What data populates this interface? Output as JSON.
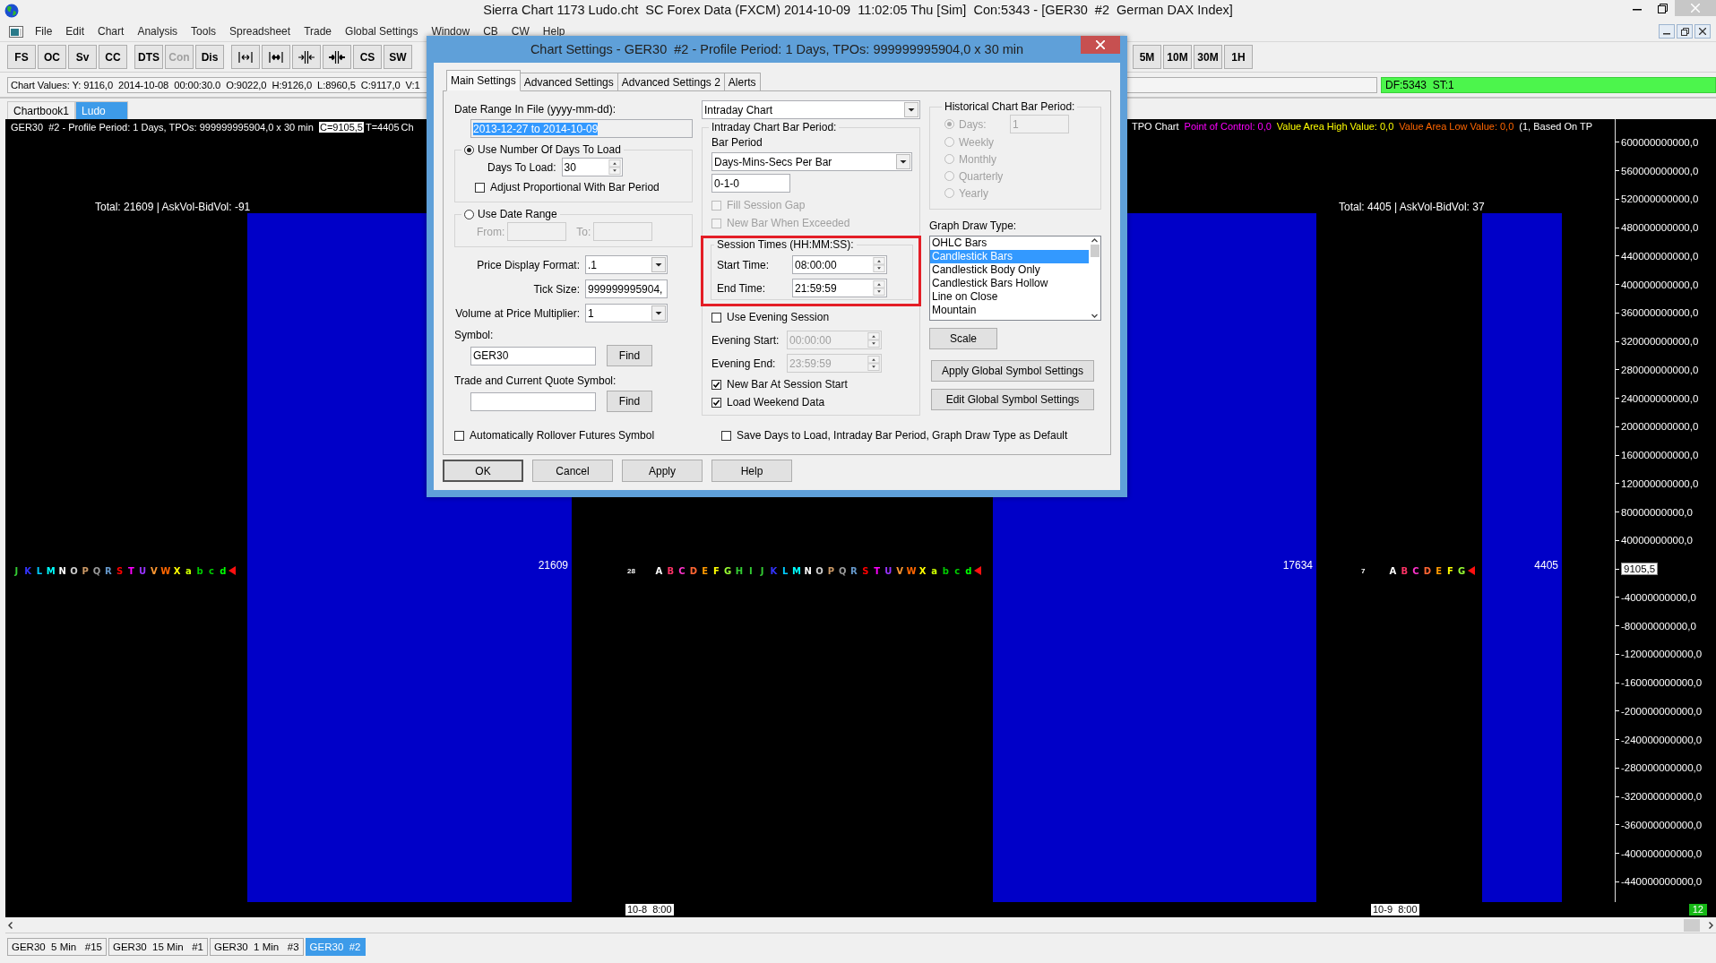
{
  "app": {
    "title": "Sierra Chart 1173 Ludo.cht  SC Forex Data (FXCM) 2014-10-09  11:02:05 Thu [Sim]  Con:5343 - [GER30  #2  German DAX Index]"
  },
  "menu": [
    "File",
    "Edit",
    "Chart",
    "Analysis",
    "Tools",
    "Spreadsheet",
    "Trade",
    "Global Settings",
    "Window",
    "CB",
    "CW",
    "Help"
  ],
  "toolbar": {
    "group_1": [
      {
        "label": "FS",
        "disabled": false
      },
      {
        "label": "OC",
        "disabled": false
      },
      {
        "label": "Sv",
        "disabled": false
      },
      {
        "label": "CC",
        "disabled": false
      }
    ],
    "group_2": [
      {
        "label": "DTS",
        "disabled": false
      },
      {
        "label": "Con",
        "disabled": true
      },
      {
        "label": "Dis",
        "disabled": false
      }
    ],
    "group_3": [
      {
        "label": "CS",
        "disabled": false
      },
      {
        "label": "SW",
        "disabled": false
      }
    ],
    "group_4": [
      {
        "label": "5M",
        "disabled": false
      },
      {
        "label": "10M",
        "disabled": false
      },
      {
        "label": "30M",
        "disabled": false
      },
      {
        "label": "1H",
        "disabled": false
      }
    ]
  },
  "chart_values": "Chart Values: Y: 9116,0  2014-10-08  00:00:30.0  O:9022,0  H:9126,0  L:8960,5  C:9117,0  V:1",
  "status": "DF:5343  ST:1",
  "chartbook_tabs": [
    {
      "label": "Chartbook1",
      "selected": false
    },
    {
      "label": "Ludo",
      "selected": true
    }
  ],
  "chart": {
    "header": {
      "study": "GER30  #2 - Profile Period: 1 Days, TPOs: 999999995904,0 x 30 min",
      "close": "C=9105,5",
      "tpo_count": "T=4405",
      "cut": "Ch"
    },
    "legend": [
      {
        "text": "TPO Chart",
        "color": "#ffffff"
      },
      {
        "text": "Point of Control: 0,0",
        "color": "#ff00ff"
      },
      {
        "text": "Value Area High Value: 0,0",
        "color": "#ffff00"
      },
      {
        "text": "Value Area Low Value: 0,0",
        "color": "#ff6600"
      },
      {
        "text": "(1, Based On TP",
        "color": "#ffffff"
      }
    ],
    "profiles": [
      {
        "total": "Total: 21609 | AskVol-BidVol: -91",
        "volume": "21609",
        "letters": [
          {
            "letter": "J",
            "color": "#33cc33"
          },
          {
            "letter": "K",
            "color": "#3333ff"
          },
          {
            "letter": "L",
            "color": "#00ccff"
          },
          {
            "letter": "M",
            "color": "#00ffff"
          },
          {
            "letter": "N",
            "color": "#ffffff"
          },
          {
            "letter": "O",
            "color": "#cccccc"
          },
          {
            "letter": "P",
            "color": "#cc9966"
          },
          {
            "letter": "Q",
            "color": "#999999"
          },
          {
            "letter": "R",
            "color": "#6699cc"
          },
          {
            "letter": "S",
            "color": "#ff0000"
          },
          {
            "letter": "T",
            "color": "#ff00ff"
          },
          {
            "letter": "U",
            "color": "#9933ff"
          },
          {
            "letter": "V",
            "color": "#ff9933"
          },
          {
            "letter": "W",
            "color": "#ff6600"
          },
          {
            "letter": "X",
            "color": "#ffff00"
          },
          {
            "letter": "a",
            "color": "#ccff00"
          },
          {
            "letter": "b",
            "color": "#00cc00"
          },
          {
            "letter": "c",
            "color": "#00cc00"
          },
          {
            "letter": "d",
            "color": "#00ff00"
          }
        ]
      },
      {
        "count": "28",
        "volume": "17634",
        "letters": [
          {
            "letter": "A",
            "color": "#ffffff"
          },
          {
            "letter": "B",
            "color": "#ff3366"
          },
          {
            "letter": "C",
            "color": "#ff33cc"
          },
          {
            "letter": "D",
            "color": "#ff6633"
          },
          {
            "letter": "E",
            "color": "#ff9900"
          },
          {
            "letter": "F",
            "color": "#ffff00"
          },
          {
            "letter": "G",
            "color": "#99ff33"
          },
          {
            "letter": "H",
            "color": "#33cc33"
          },
          {
            "letter": "I",
            "color": "#33cc33"
          },
          {
            "letter": "J",
            "color": "#33cc33"
          },
          {
            "letter": "K",
            "color": "#3333ff"
          },
          {
            "letter": "L",
            "color": "#00ccff"
          },
          {
            "letter": "M",
            "color": "#00ffff"
          },
          {
            "letter": "N",
            "color": "#ffffff"
          },
          {
            "letter": "O",
            "color": "#cccccc"
          },
          {
            "letter": "P",
            "color": "#cc9966"
          },
          {
            "letter": "Q",
            "color": "#999999"
          },
          {
            "letter": "R",
            "color": "#6699cc"
          },
          {
            "letter": "S",
            "color": "#ff0000"
          },
          {
            "letter": "T",
            "color": "#ff00ff"
          },
          {
            "letter": "U",
            "color": "#9933ff"
          },
          {
            "letter": "V",
            "color": "#ff9933"
          },
          {
            "letter": "W",
            "color": "#ff6600"
          },
          {
            "letter": "X",
            "color": "#ffff00"
          },
          {
            "letter": "a",
            "color": "#ccff00"
          },
          {
            "letter": "b",
            "color": "#00cc00"
          },
          {
            "letter": "c",
            "color": "#00cc00"
          },
          {
            "letter": "d",
            "color": "#00ff00"
          }
        ]
      },
      {
        "total": "Total: 4405 | AskVol-BidVol: 37",
        "count": "7",
        "volume": "4405",
        "letters": [
          {
            "letter": "A",
            "color": "#ffffff"
          },
          {
            "letter": "B",
            "color": "#ff3366"
          },
          {
            "letter": "C",
            "color": "#ff33cc"
          },
          {
            "letter": "D",
            "color": "#ff6633"
          },
          {
            "letter": "E",
            "color": "#ff9900"
          },
          {
            "letter": "F",
            "color": "#ffff00"
          },
          {
            "letter": "G",
            "color": "#99ff33"
          }
        ]
      }
    ],
    "price_axis": [
      {
        "label": "600000000000,0",
        "kind": "tick"
      },
      {
        "label": "560000000000,0",
        "kind": "tick"
      },
      {
        "label": "520000000000,0",
        "kind": "tick"
      },
      {
        "label": "480000000000,0",
        "kind": "tick"
      },
      {
        "label": "440000000000,0",
        "kind": "tick"
      },
      {
        "label": "400000000000,0",
        "kind": "tick"
      },
      {
        "label": "360000000000,0",
        "kind": "tick"
      },
      {
        "label": "320000000000,0",
        "kind": "tick"
      },
      {
        "label": "280000000000,0",
        "kind": "tick"
      },
      {
        "label": "240000000000,0",
        "kind": "tick"
      },
      {
        "label": "200000000000,0",
        "kind": "tick"
      },
      {
        "label": "160000000000,0",
        "kind": "tick"
      },
      {
        "label": "120000000000,0",
        "kind": "tick"
      },
      {
        "label": "80000000000,0",
        "kind": "tick"
      },
      {
        "label": "40000000000,0",
        "kind": "tick"
      },
      {
        "label": "9105,5",
        "kind": "marker"
      },
      {
        "label": "-40000000000,0",
        "kind": "tick"
      },
      {
        "label": "-80000000000,0",
        "kind": "tick"
      },
      {
        "label": "-120000000000,0",
        "kind": "tick"
      },
      {
        "label": "-160000000000,0",
        "kind": "tick"
      },
      {
        "label": "-200000000000,0",
        "kind": "tick"
      },
      {
        "label": "-240000000000,0",
        "kind": "tick"
      },
      {
        "label": "-280000000000,0",
        "kind": "tick"
      },
      {
        "label": "-320000000000,0",
        "kind": "tick"
      },
      {
        "label": "-360000000000,0",
        "kind": "tick"
      },
      {
        "label": "-400000000000,0",
        "kind": "tick"
      },
      {
        "label": "-440000000000,0",
        "kind": "tick"
      }
    ],
    "time_labels": [
      "10-8  8:00",
      "10-9  8:00"
    ],
    "bar_count": "12"
  },
  "bottom_tabs": [
    {
      "label": "GER30  5 Min   #15",
      "selected": false
    },
    {
      "label": "GER30  15 Min   #1",
      "selected": false
    },
    {
      "label": "GER30  1 Min   #3",
      "selected": false
    },
    {
      "label": "GER30  #2",
      "selected": true
    }
  ],
  "dialog": {
    "title": "Chart Settings - GER30  #2 - Profile Period: 1 Days, TPOs: 999999995904,0 x 30 min",
    "tabs": [
      {
        "label": "Main Settings",
        "selected": true
      },
      {
        "label": "Advanced Settings",
        "selected": false
      },
      {
        "label": "Advanced Settings 2",
        "selected": false
      },
      {
        "label": "Alerts",
        "selected": false
      }
    ],
    "date_range": {
      "label": "Date Range In File (yyyy-mm-dd):",
      "value": "2013-12-27 to 2014-10-09",
      "text_selected": true
    },
    "load_modes": [
      {
        "label": "Use Number Of Days To Load",
        "selected": true
      },
      {
        "label": "Use Date Range",
        "selected": false
      }
    ],
    "days_to_load": {
      "label": "Days To Load:",
      "value": "30"
    },
    "adjust_proportional": {
      "label": "Adjust Proportional With Bar Period",
      "checked": false,
      "disabled": false
    },
    "from": {
      "label": "From:",
      "disabled": true
    },
    "to": {
      "label": "To:",
      "disabled": true
    },
    "price_display_format": {
      "label": "Price Display Format:",
      "value": ".1"
    },
    "tick_size": {
      "label": "Tick Size:",
      "value": "999999995904,"
    },
    "volume_multiplier": {
      "label": "Volume at Price Multiplier:",
      "value": "1"
    },
    "symbol": {
      "label": "Symbol:",
      "value": "GER30",
      "button": "Find"
    },
    "quote_symbol": {
      "label": "Trade and Current Quote Symbol:",
      "button": "Find"
    },
    "rollover": {
      "label": "Automatically Rollover Futures Symbol",
      "checked": false,
      "disabled": false
    },
    "chart_type": "Intraday Chart",
    "intraday": {
      "title": "Intraday Chart Bar Period:",
      "bar_period_label": "Bar Period",
      "bar_period_type": "Days-Mins-Secs Per Bar",
      "bar_period_value": "0-1-0",
      "options": [
        {
          "label": "Fill Session Gap",
          "checked": false,
          "disabled": true
        },
        {
          "label": "New Bar When Exceeded",
          "checked": false,
          "disabled": true
        }
      ],
      "session": {
        "title": "Session Times (HH:MM:SS):",
        "highlighted": true,
        "times": [
          {
            "label": "Start Time:",
            "value": "08:00:00",
            "disabled": false
          },
          {
            "label": "End Time:",
            "value": "21:59:59",
            "disabled": false
          }
        ]
      },
      "use_evening": {
        "label": "Use Evening Session",
        "checked": false,
        "disabled": false
      },
      "evening_times": [
        {
          "label": "Evening Start:",
          "value": "00:00:00",
          "disabled": true
        },
        {
          "label": "Evening End:",
          "value": "23:59:59",
          "disabled": true
        }
      ],
      "flags": [
        {
          "label": "New Bar At Session Start",
          "checked": true,
          "disabled": false
        },
        {
          "label": "Load Weekend Data",
          "checked": true,
          "disabled": false
        }
      ]
    },
    "historical": {
      "title": "Historical Chart Bar Period:",
      "days_value": "1",
      "periods": [
        {
          "label": "Days:",
          "selected": true,
          "disabled": true
        },
        {
          "label": "Weekly",
          "selected": false,
          "disabled": true
        },
        {
          "label": "Monthly",
          "selected": false,
          "disabled": true
        },
        {
          "label": "Quarterly",
          "selected": false,
          "disabled": true
        },
        {
          "label": "Yearly",
          "selected": false,
          "disabled": true
        }
      ]
    },
    "graph_draw_type": {
      "label": "Graph Draw Type:",
      "items": [
        {
          "label": "OHLC Bars",
          "selected": false
        },
        {
          "label": "Candlestick Bars",
          "selected": true
        },
        {
          "label": "Candlestick Body Only",
          "selected": false
        },
        {
          "label": "Candlestick Bars Hollow",
          "selected": false
        },
        {
          "label": "Line on Close",
          "selected": false
        },
        {
          "label": "Mountain",
          "selected": false
        }
      ]
    },
    "side_buttons": [
      "Scale",
      "Apply Global Symbol Settings",
      "Edit Global Symbol Settings"
    ],
    "save_default": {
      "label": "Save Days to Load, Intraday Bar Period, Graph Draw Type as Default",
      "checked": false,
      "disabled": false
    },
    "footer_buttons": [
      {
        "label": "OK",
        "default": true
      },
      {
        "label": "Cancel",
        "default": false
      },
      {
        "label": "Apply",
        "default": false
      },
      {
        "label": "Help",
        "default": false
      }
    ]
  }
}
